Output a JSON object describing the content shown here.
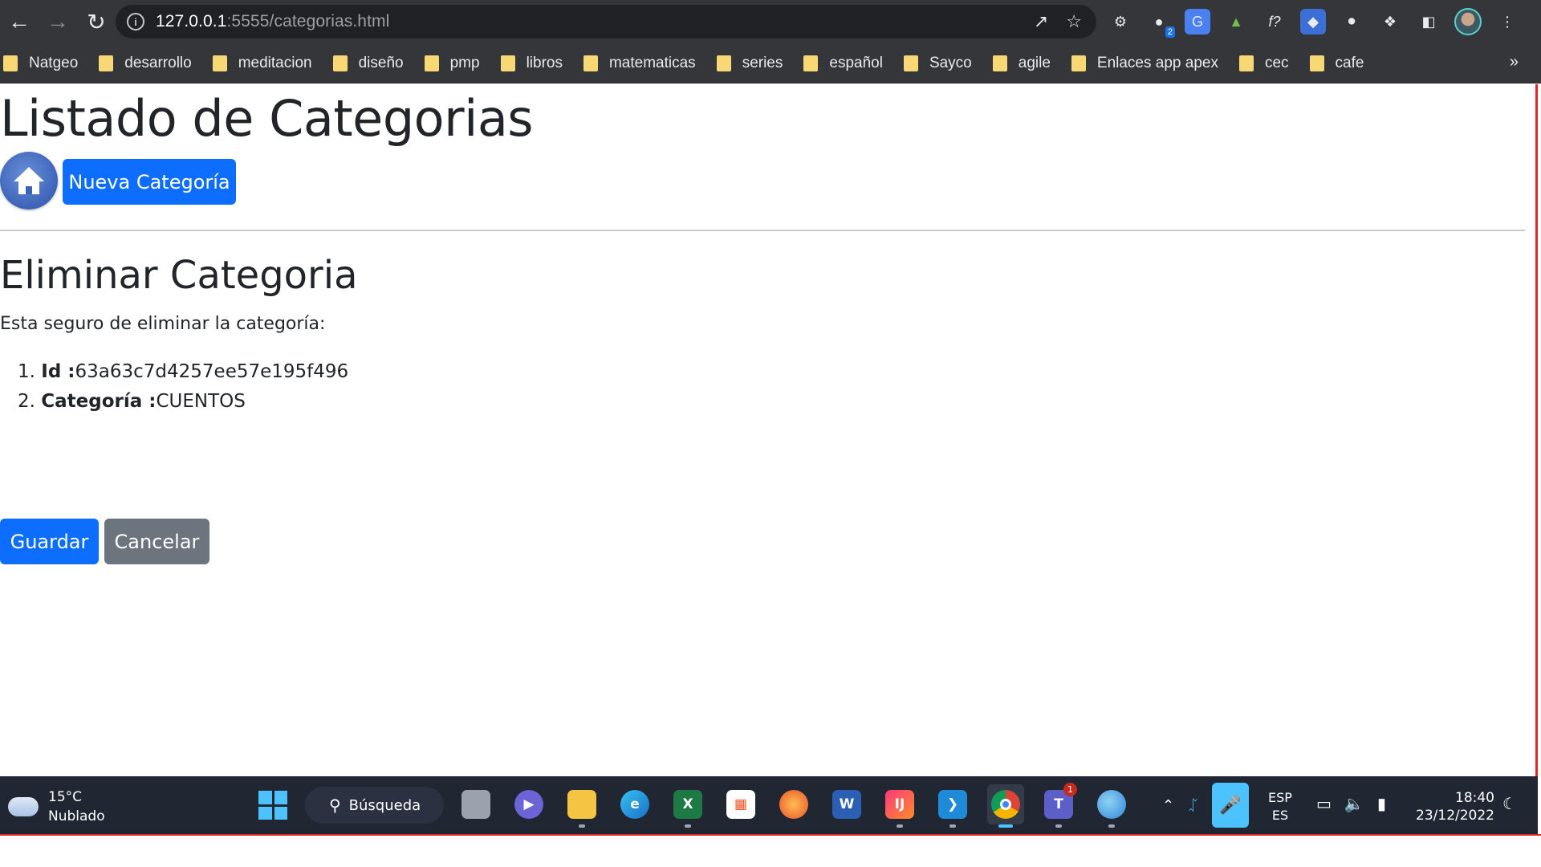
{
  "browser": {
    "url_host": "127.0.0.1",
    "url_path": ":5555/categorias.html",
    "extension_badge": "2",
    "bookmarks": [
      "Natgeo",
      "desarrollo",
      "meditacion",
      "diseño",
      "pmp",
      "libros",
      "matematicas",
      "series",
      "español",
      "Sayco",
      "agile",
      "Enlaces app apex",
      "cec",
      "cafe"
    ],
    "more": "»"
  },
  "page": {
    "title": "Listado de Categorias",
    "new_button": "Nueva Categoría",
    "section_title": "Eliminar Categoria",
    "confirm_text": "Esta seguro de eliminar la categoría:",
    "details": [
      {
        "num": "1.",
        "label": "Id :",
        "value": "63a63c7d4257ee57e195f496"
      },
      {
        "num": "2.",
        "label": "Categoría :",
        "value": "CUENTOS"
      }
    ],
    "save_button": "Guardar",
    "cancel_button": "Cancelar",
    "colors": {
      "primary": "#0d6efd",
      "secondary": "#6c757d",
      "text": "#212529"
    }
  },
  "taskbar": {
    "temperature": "15°C",
    "weather": "Nublado",
    "search": "Búsqueda",
    "teams_badge": "1",
    "lang_top": "ESP",
    "lang_bottom": "ES",
    "time": "18:40",
    "date": "23/12/2022"
  }
}
